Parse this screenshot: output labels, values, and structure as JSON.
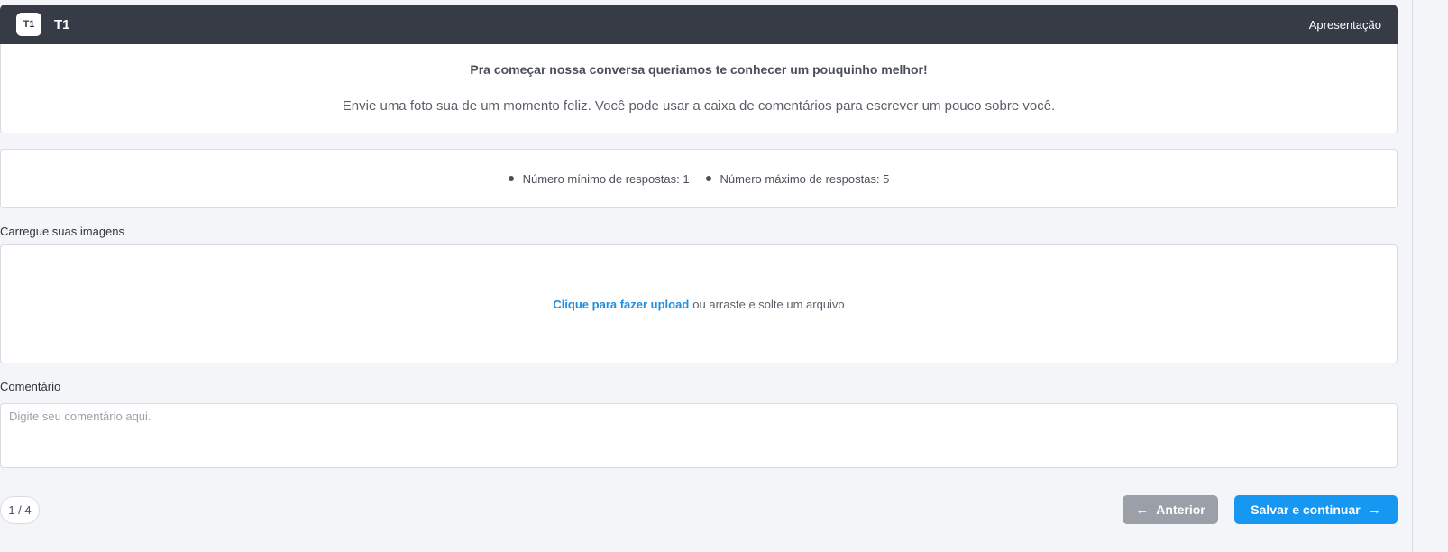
{
  "header": {
    "logo_text": "T1",
    "title": "T1",
    "section": "Apresentação"
  },
  "intro": {
    "heading": "Pra começar nossa conversa queriamos te conhecer um pouquinho melhor!",
    "body": "Envie uma foto sua de um momento feliz. Você pode usar a caixa de comentários para escrever um pouco sobre você."
  },
  "rules": {
    "min": "Número mínimo de respostas: 1",
    "max": "Número máximo de respostas: 5"
  },
  "upload": {
    "label": "Carregue suas imagens",
    "link": "Clique para fazer upload",
    "hint": "ou arraste e solte um arquivo"
  },
  "comment": {
    "label": "Comentário",
    "placeholder": "Digite seu comentário aqui.",
    "value": ""
  },
  "footer": {
    "page_indicator": "1 / 4",
    "prev_label": "Anterior",
    "next_label": "Salvar e continuar",
    "prev_icon": "arrow-left-icon",
    "next_icon": "arrow-right-icon"
  },
  "colors": {
    "header_bg": "#363b46",
    "accent": "#1597f2",
    "link": "#1a8fe3",
    "disabled_button": "#9ba0a8",
    "page_bg": "#f4f5f8"
  }
}
